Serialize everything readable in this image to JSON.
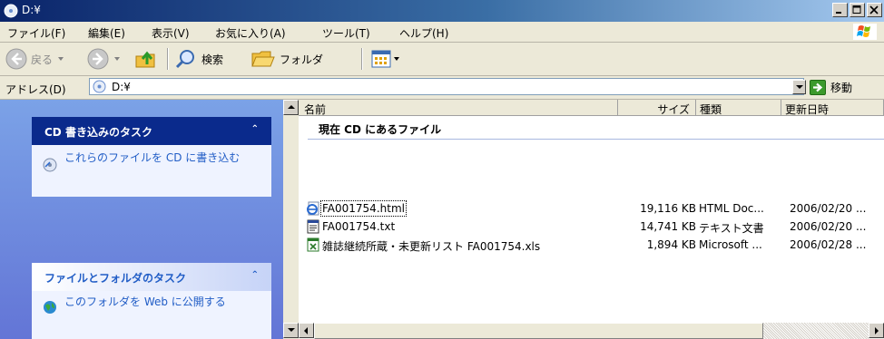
{
  "window": {
    "title": "D:¥"
  },
  "menu": {
    "items": [
      "ファイル(F)",
      "編集(E)",
      "表示(V)",
      "お気に入り(A)",
      "ツール(T)",
      "ヘルプ(H)"
    ]
  },
  "toolbar": {
    "back": "戻る",
    "search": "検索",
    "folders": "フォルダ"
  },
  "address": {
    "label": "アドレス(D)",
    "value": "D:¥",
    "go": "移動"
  },
  "tasks": {
    "cd_panel_title": "CD 書き込みのタスク",
    "cd_write": "これらのファイルを CD に書き込む",
    "file_panel_title": "ファイルとフォルダのタスク",
    "publish_web": "このフォルダを Web に公開する"
  },
  "columns": {
    "name": "名前",
    "size": "サイズ",
    "type": "種類",
    "date": "更新日時"
  },
  "group": {
    "title": "現在 CD にあるファイル"
  },
  "files": [
    {
      "name": "FA001754.html",
      "size": "19,116 KB",
      "type": "HTML Doc...",
      "date": "2006/02/20 ..."
    },
    {
      "name": "FA001754.txt",
      "size": "14,741 KB",
      "type": "テキスト文書",
      "date": "2006/02/20 ..."
    },
    {
      "name": "雑誌継続所蔵・未更新リスト FA001754.xls",
      "size": "1,894 KB",
      "type": "Microsoft ...",
      "date": "2006/02/28 ..."
    }
  ],
  "colors": {
    "title_dark": "#0a246a",
    "task_pane": "#7ba2e7",
    "cd_header": "#0a2a8c",
    "link": "#215dc6"
  }
}
